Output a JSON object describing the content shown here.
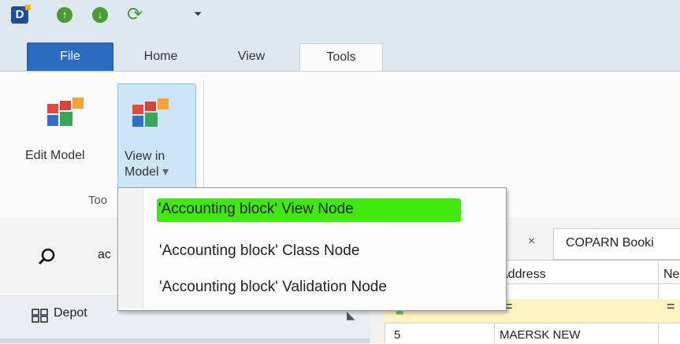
{
  "quick_access": {
    "logo_letter": "D",
    "up_glyph": "↑",
    "down_glyph": "↓",
    "refresh_glyph": "⟳",
    "customize_glyph": "⏷",
    "icons": [
      "app-logo-icon",
      "arrow-up-icon",
      "arrow-down-icon",
      "refresh-icon",
      "customize-icon"
    ]
  },
  "tabs": [
    {
      "label": "File"
    },
    {
      "label": "Home"
    },
    {
      "label": "View"
    },
    {
      "label": "Tools",
      "active": true
    }
  ],
  "ribbon": {
    "edit_model": {
      "label": "Edit Model"
    },
    "view_in_model": {
      "line1": "View in",
      "line2": "Model",
      "arrow": "▾"
    },
    "group_label": "Too"
  },
  "dropdown": {
    "items": [
      {
        "label": "'Accounting block' View Node",
        "highlighted": true
      },
      {
        "label": "'Accounting block' Class Node"
      },
      {
        "label": "'Accounting block' Validation Node"
      }
    ]
  },
  "sidebar": {
    "search_text": "ac",
    "depot_label": "Depot",
    "pin_glyph": "◣"
  },
  "document": {
    "close_glyph": "×",
    "tab_label": "COPARN Booki",
    "grid_headers": [
      "Address",
      "Ne"
    ],
    "filter_eq": [
      "=",
      "="
    ],
    "rows": [
      {
        "id": "5",
        "address": "MAERSK NEW"
      }
    ]
  },
  "colors": {
    "file_tab": "#2a6dc0",
    "highlight": "#41e80f",
    "selected_button": "#cde6f7",
    "title_bar": "#dfe8f1"
  }
}
